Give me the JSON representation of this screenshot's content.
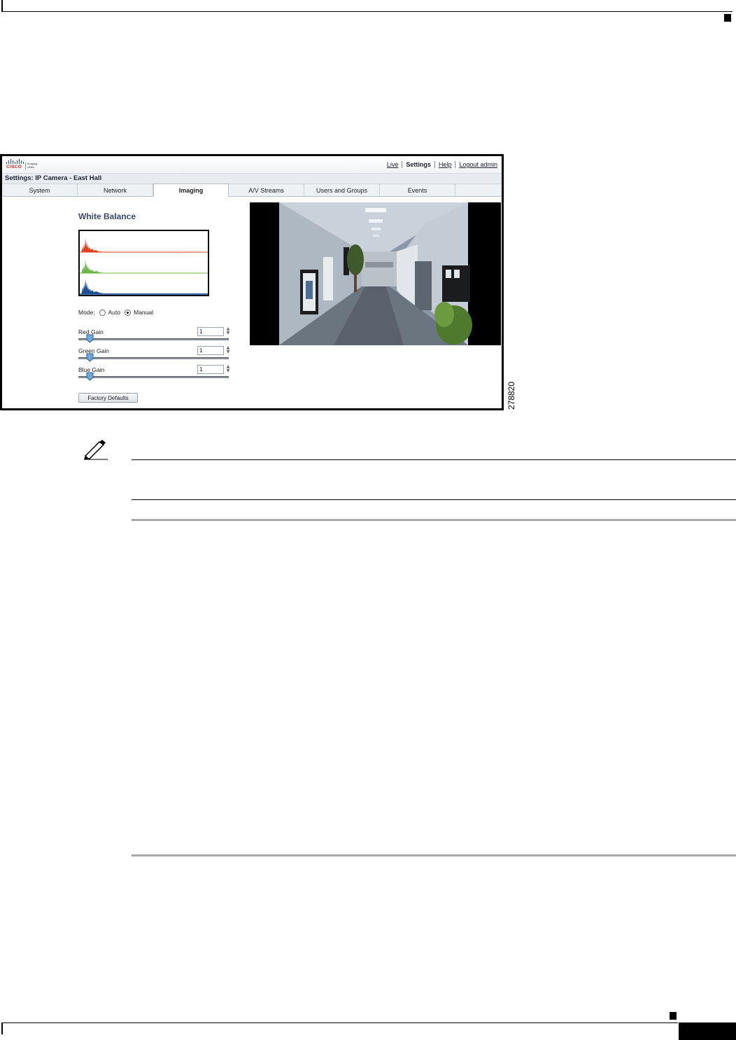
{
  "app": {
    "top_links": {
      "live": "Live",
      "settings": "Settings",
      "help": "Help",
      "logout": "Logout admin"
    },
    "logo": {
      "word": "CISCO",
      "product_line1": "Imaging",
      "product_line2": "Video"
    },
    "title": "Settings: IP Camera - East Hall"
  },
  "tabs": [
    {
      "label": "System"
    },
    {
      "label": "Network"
    },
    {
      "label": "Imaging",
      "selected": true
    },
    {
      "label": "A/V Streams"
    },
    {
      "label": "Users and Groups"
    },
    {
      "label": "Events"
    }
  ],
  "white_balance": {
    "title": "White Balance",
    "mode_label": "Mode:",
    "mode_options": [
      "Auto",
      "Manual"
    ],
    "mode_selected": "Manual",
    "gains": [
      {
        "label": "Red Gain",
        "value": "1"
      },
      {
        "label": "Green Gain",
        "value": "1"
      },
      {
        "label": "Blue Gain",
        "value": "1"
      }
    ],
    "factory_defaults_label": "Factory Defaults",
    "histogram_colors": {
      "red": "#e0401c",
      "green": "#6ab84a",
      "blue": "#1d4f94"
    }
  },
  "figure_id": "278820",
  "colors": {
    "title_text": "#3a4a6a",
    "tab_bar": "#eef1f4"
  }
}
